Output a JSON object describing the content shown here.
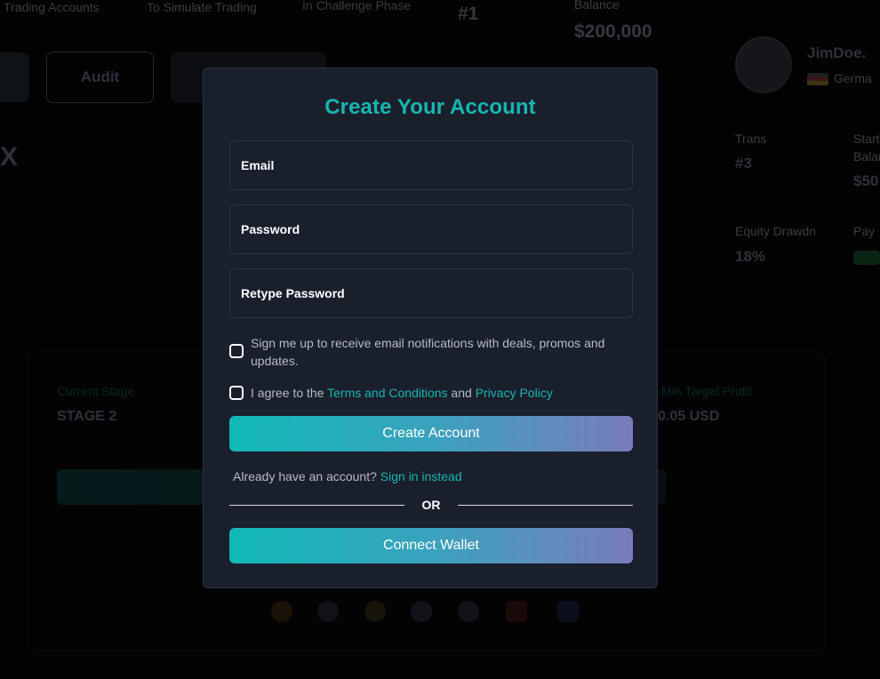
{
  "background": {
    "header_stats": [
      "Trading Accounts",
      "To Simulate Trading",
      "In Challenge Phase"
    ],
    "rank_value": "#1",
    "balance_label": "Balance",
    "balance_value": "$200,000",
    "audit_label": "Audit",
    "close_glyph": "X",
    "user_name": "JimDoe.",
    "user_country": "Germa",
    "trans_label": "Trans",
    "trans_value": "#3",
    "right_label_a": "Start",
    "right_label_b": "Balan",
    "right_value": "$50",
    "equity_label": "Equity Drawdn",
    "equity_value": "18%",
    "payout_label": "Pay",
    "panel_label_left": "Current Stage",
    "panel_value_left": "STAGE 2",
    "panel_label_right": "Min Target Profit",
    "panel_value_right": "0.05 USD"
  },
  "modal": {
    "title": "Create Your Account",
    "email_placeholder": "Email",
    "password_placeholder": "Password",
    "retype_placeholder": "Retype Password",
    "newsletter_text": "Sign me up to receive email notifications with deals, promos and updates.",
    "agree_prefix": "I agree to the ",
    "terms_link": "Terms and Conditions",
    "agree_and": " and ",
    "privacy_link": "Privacy Policy",
    "create_button": "Create Account",
    "have_account_text": "Already have an account? ",
    "signin_link": "Sign in instead",
    "or_text": "OR",
    "wallet_button": "Connect Wallet"
  },
  "colors": {
    "accent": "#17b6b0",
    "modal_bg": "#1a1f2c",
    "gradient_start": "#10b9b7",
    "gradient_end": "#7a7cbc"
  }
}
